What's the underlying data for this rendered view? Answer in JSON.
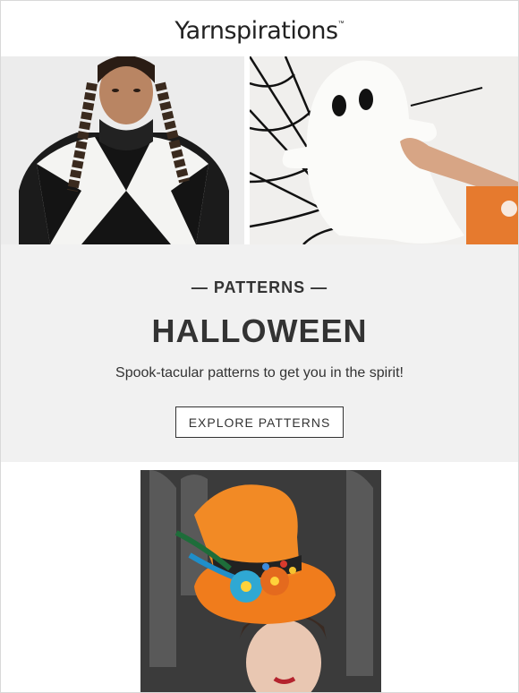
{
  "header": {
    "logo_text": "Yarnspirations",
    "logo_tm": "™"
  },
  "hero": {
    "left_image_alt": "Knitted black and white diamond sweater",
    "right_image_alt": "Crochet ghost pillow"
  },
  "banner": {
    "eyebrow": "— PATTERNS —",
    "title": "HALLOWEEN",
    "subtitle": "Spook-tacular patterns to get you in the spirit!",
    "cta_label": "EXPLORE PATTERNS"
  },
  "feature": {
    "image_alt": "Orange crochet top hat"
  },
  "colors": {
    "banner_bg": "#f1f1f1",
    "text": "#333333",
    "hat_orange": "#f07c1c"
  }
}
